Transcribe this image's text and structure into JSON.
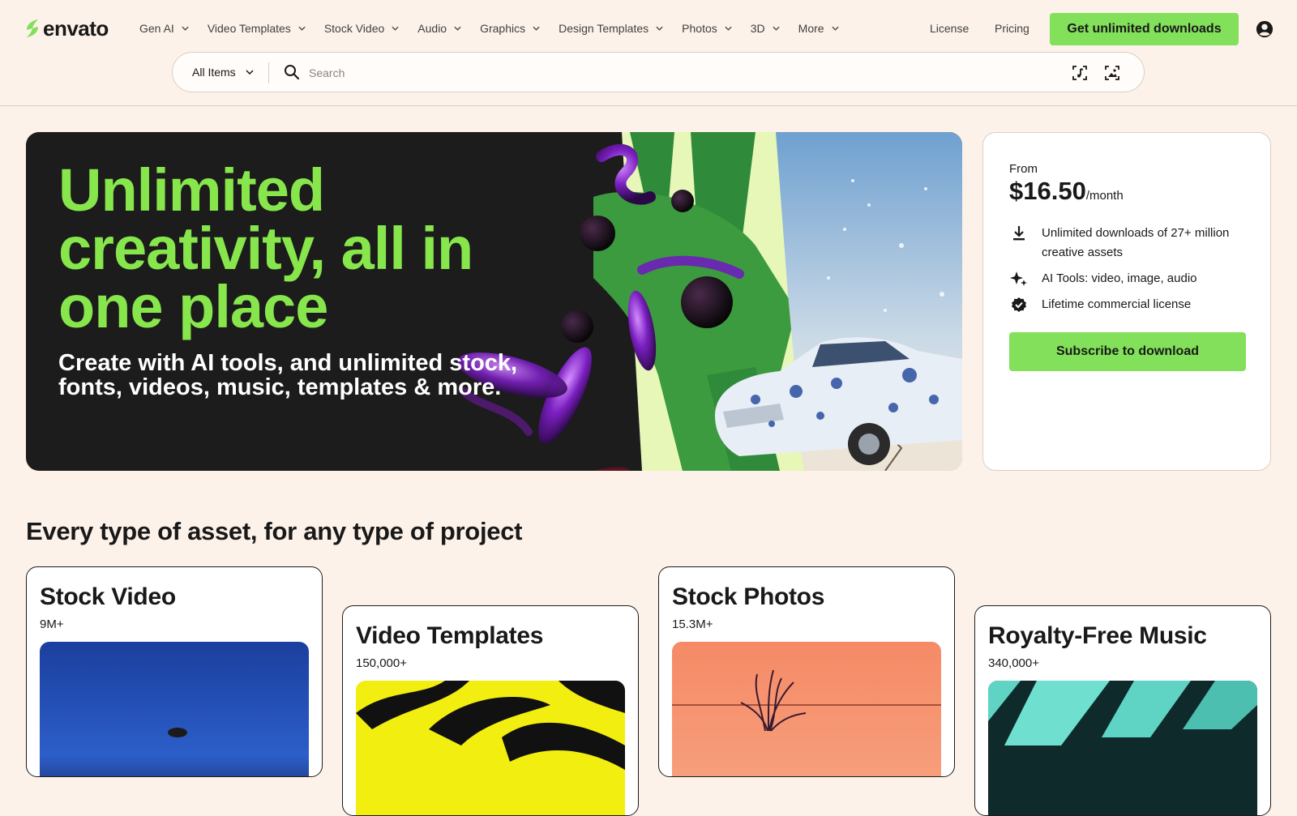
{
  "brand": {
    "name": "envato",
    "accent": "#82e05a",
    "headline_color": "#87e64b"
  },
  "nav": {
    "items": [
      {
        "label": "Gen AI"
      },
      {
        "label": "Video Templates"
      },
      {
        "label": "Stock Video"
      },
      {
        "label": "Audio"
      },
      {
        "label": "Graphics"
      },
      {
        "label": "Design Templates"
      },
      {
        "label": "Photos"
      },
      {
        "label": "3D"
      },
      {
        "label": "More"
      }
    ],
    "license": "License",
    "pricing": "Pricing",
    "cta": "Get unlimited downloads",
    "account_icon": "account-circle-icon"
  },
  "search": {
    "category": "All Items",
    "placeholder": "Search",
    "value": "",
    "icons": [
      "search-icon",
      "audio-search-icon",
      "image-search-icon"
    ]
  },
  "hero": {
    "title": "Unlimited creativity, all in one place",
    "subtitle": "Create with AI tools, and unlimited stock, fonts, videos, music, templates & more."
  },
  "pricing": {
    "from_label": "From",
    "price": "$16.50",
    "period": "/month",
    "features": [
      {
        "icon": "download-icon",
        "text": "Unlimited downloads of 27+ million creative assets"
      },
      {
        "icon": "sparkles-icon",
        "text": "AI Tools: video, image, audio"
      },
      {
        "icon": "verified-badge-icon",
        "text": "Lifetime commercial license"
      }
    ],
    "button": "Subscribe to download"
  },
  "assets": {
    "title": "Every type of asset, for any type of project",
    "cards": [
      {
        "name": "Stock Video",
        "count": "9M+"
      },
      {
        "name": "Video Templates",
        "count": "150,000+"
      },
      {
        "name": "Stock Photos",
        "count": "15.3M+"
      },
      {
        "name": "Royalty-Free Music",
        "count": "340,000+"
      }
    ]
  }
}
